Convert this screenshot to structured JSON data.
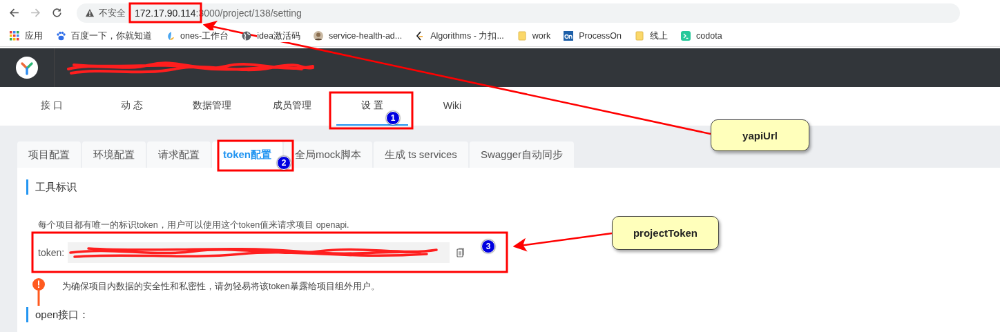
{
  "browser": {
    "security_label": "不安全",
    "url_host": "172.17.90.114",
    "url_port": ":3000",
    "url_path": "/project/138/setting"
  },
  "bookmarks": [
    {
      "label": "应用",
      "kind": "apps"
    },
    {
      "label": "百度一下，你就知道",
      "kind": "paw"
    },
    {
      "label": "ones-工作台",
      "kind": "leaf"
    },
    {
      "label": "idea激活码",
      "kind": "globe"
    },
    {
      "label": "service-health-ad...",
      "kind": "avatar"
    },
    {
      "label": "Algorithms - 力扣...",
      "kind": "bracket"
    },
    {
      "label": "work",
      "kind": "folder"
    },
    {
      "label": "ProcessOn",
      "kind": "on"
    },
    {
      "label": "线上",
      "kind": "folder"
    },
    {
      "label": "codota",
      "kind": "terminal"
    }
  ],
  "nav": [
    {
      "label": "接 口",
      "selected": false
    },
    {
      "label": "动 态",
      "selected": false
    },
    {
      "label": "数据管理",
      "selected": false
    },
    {
      "label": "成员管理",
      "selected": false
    },
    {
      "label": "设 置",
      "selected": true
    },
    {
      "label": "Wiki",
      "selected": false
    }
  ],
  "tabs": [
    {
      "label": "项目配置",
      "selected": false
    },
    {
      "label": "环境配置",
      "selected": false
    },
    {
      "label": "请求配置",
      "selected": false
    },
    {
      "label": "token配置",
      "selected": true
    },
    {
      "label": "全局mock脚本",
      "selected": false
    },
    {
      "label": "生成 ts services",
      "selected": false
    },
    {
      "label": "Swagger自动同步",
      "selected": false
    }
  ],
  "section": {
    "title": "工具标识",
    "description": "每个项目都有唯一的标识token，用户可以使用这个token值来请求项目 openapi.",
    "token_label": "token:",
    "warning": "为确保项目内数据的安全性和私密性，请勿轻易将该token暴露给项目组外用户。"
  },
  "section2": {
    "title": "open接口："
  },
  "annotations": {
    "markers": [
      "1",
      "2",
      "3"
    ],
    "callouts": [
      "yapiUrl",
      "projectToken"
    ]
  }
}
